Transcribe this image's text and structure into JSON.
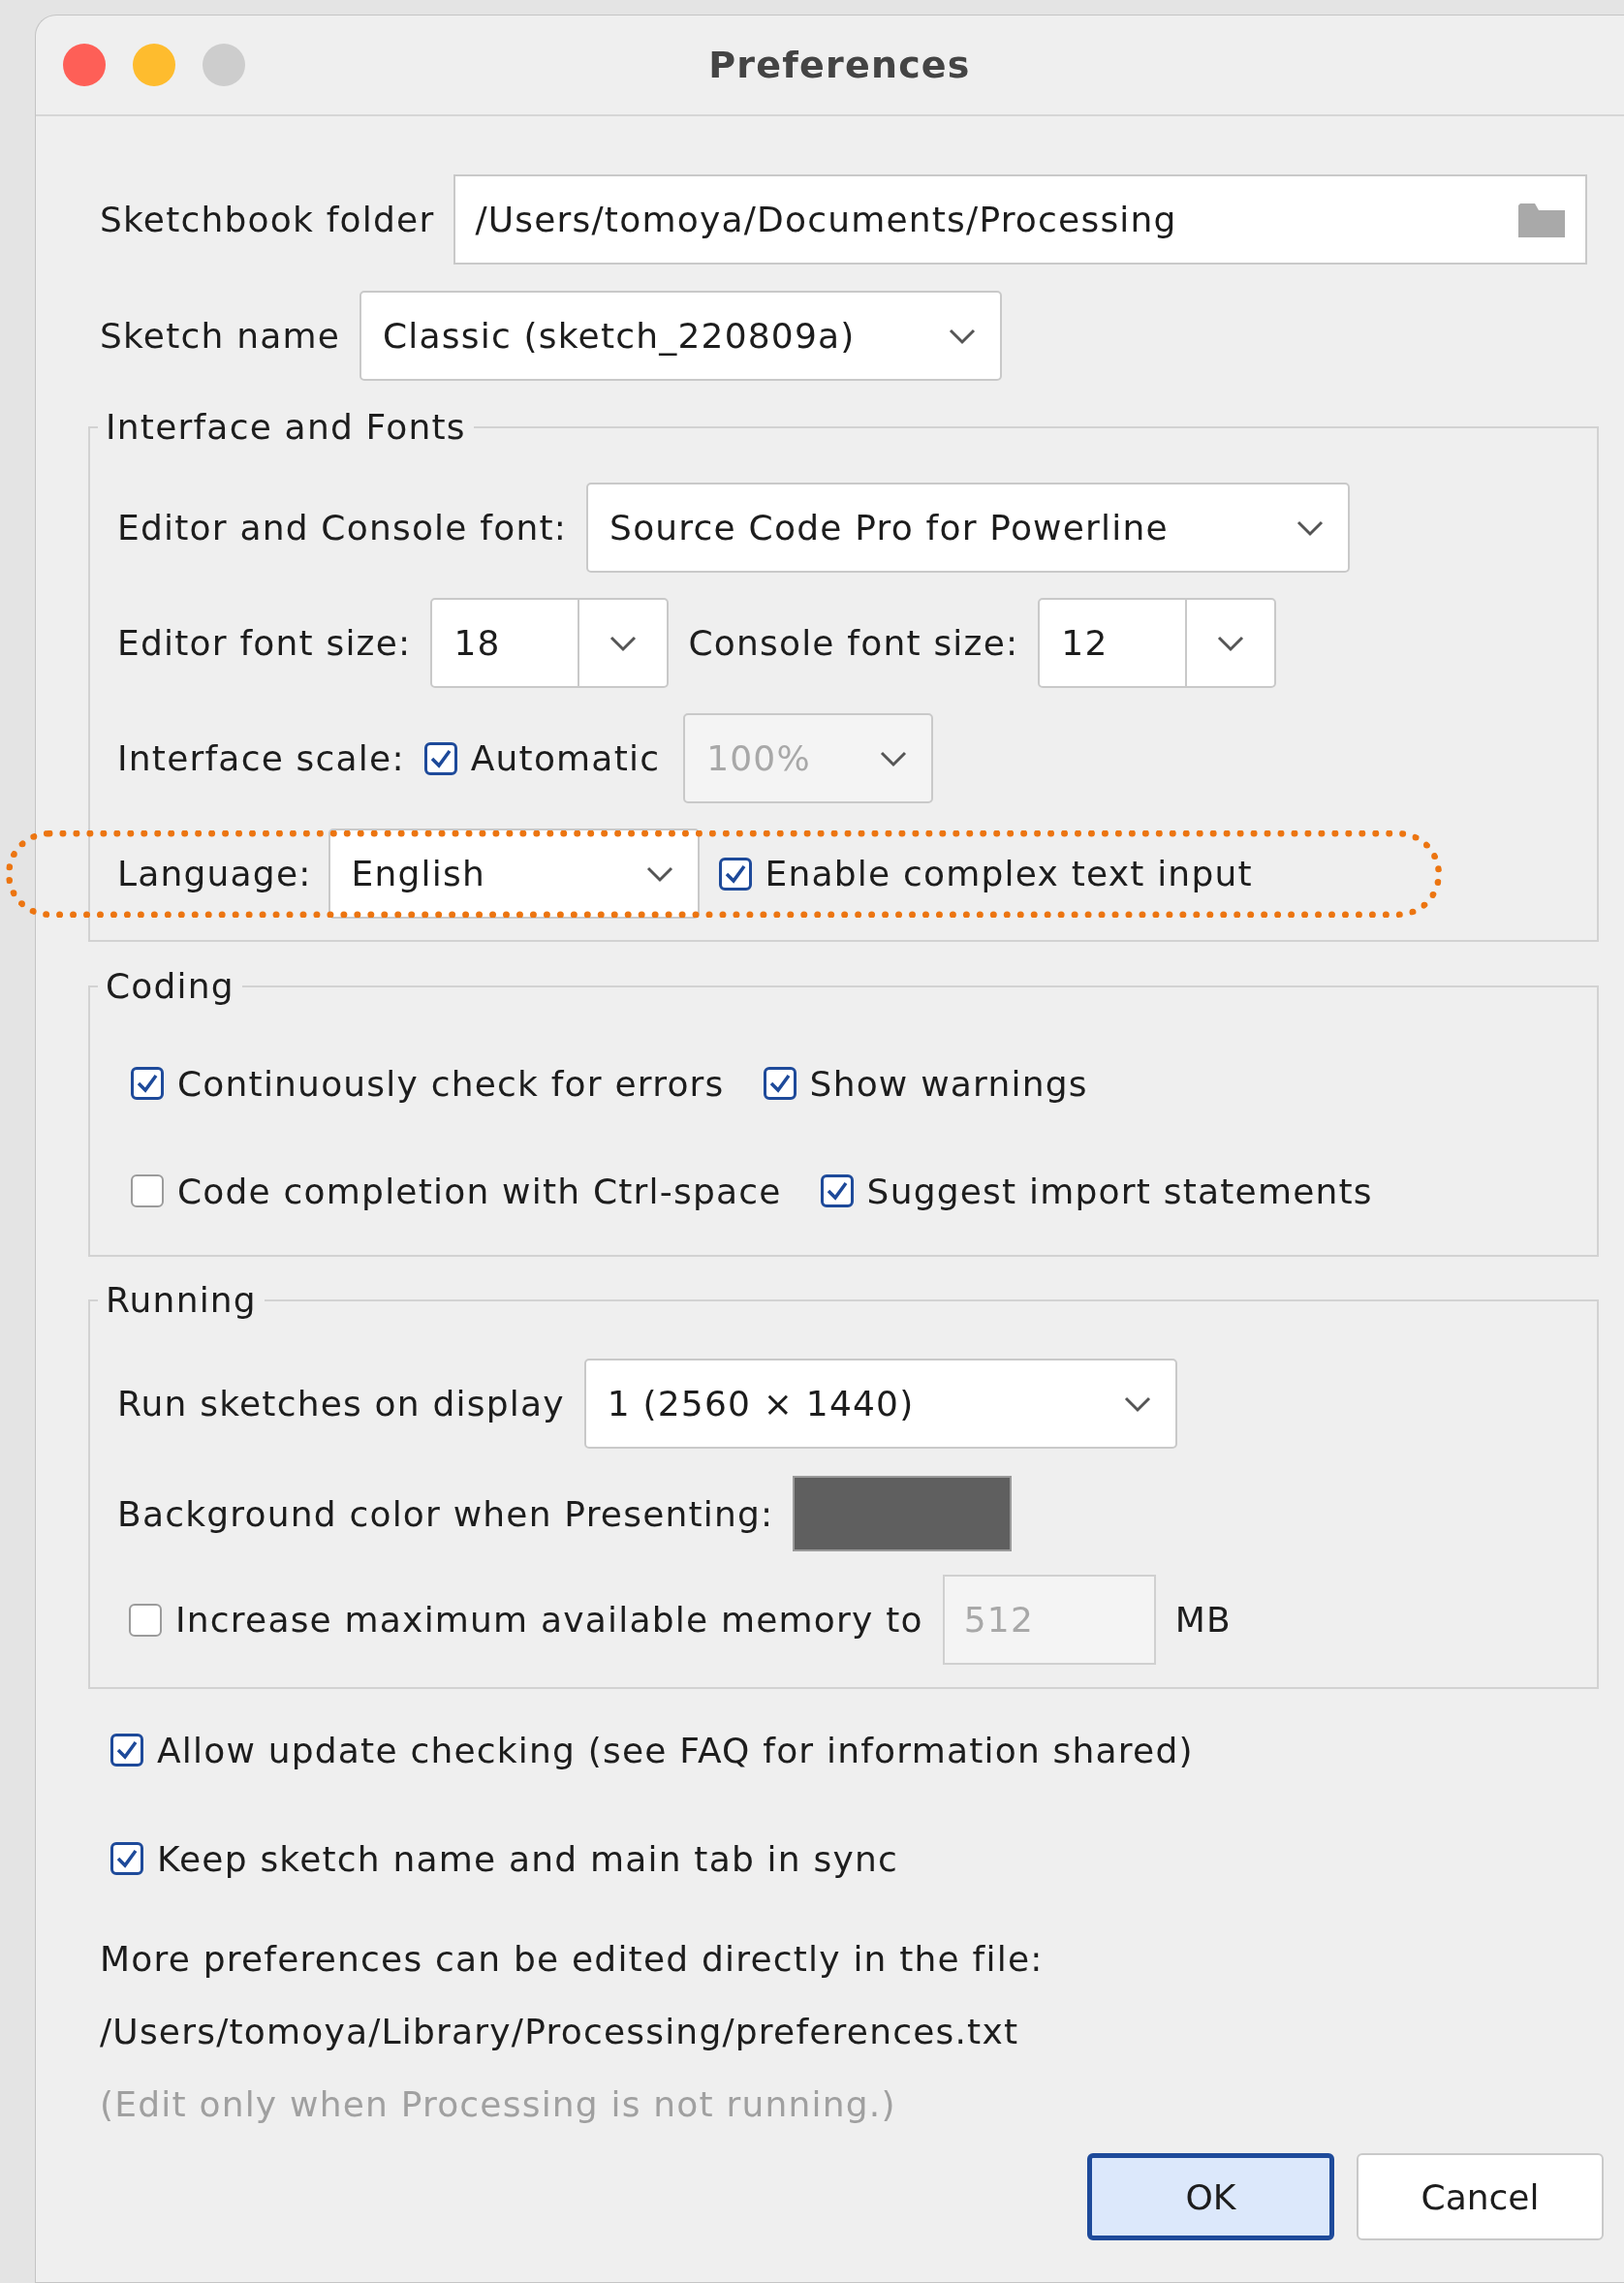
{
  "window": {
    "title": "Preferences",
    "traffic_lights": [
      {
        "color": "#fe5f57"
      },
      {
        "color": "#febc2e"
      },
      {
        "color": "#cdcdcd"
      }
    ]
  },
  "sketchbook_folder": {
    "label": "Sketchbook folder",
    "value": "/Users/tomoya/Documents/Processing"
  },
  "sketch_name": {
    "label": "Sketch name",
    "value": "Classic (sketch_220809a)"
  },
  "interface_and_fonts": {
    "title": "Interface and Fonts",
    "editor_console_font": {
      "label": "Editor and Console font:",
      "value": "Source Code Pro for Powerline"
    },
    "editor_font_size": {
      "label": "Editor font size:",
      "value": "18"
    },
    "console_font_size": {
      "label": "Console font size:",
      "value": "12"
    },
    "interface_scale": {
      "label": "Interface scale:",
      "automatic": {
        "label": "Automatic",
        "checked": true
      },
      "value": "100%",
      "disabled": true
    },
    "language": {
      "label": "Language:",
      "value": "English"
    },
    "complex_text_input": {
      "label": "Enable complex text input",
      "checked": true
    }
  },
  "coding": {
    "title": "Coding",
    "rows": [
      [
        {
          "label": "Continuously check for errors",
          "checked": true
        },
        {
          "label": "Show warnings",
          "checked": true
        }
      ],
      [
        {
          "label": "Code completion with Ctrl-space",
          "checked": false
        },
        {
          "label": "Suggest import statements",
          "checked": true
        }
      ]
    ]
  },
  "running": {
    "title": "Running",
    "display": {
      "label": "Run sketches on display",
      "value": "1 (2560 × 1440)"
    },
    "background": {
      "label": "Background color when Presenting:",
      "color": "#5f5f5f"
    },
    "memory": {
      "label": "Increase maximum available memory to",
      "checked": false,
      "value": "512",
      "unit": "MB"
    }
  },
  "options": [
    {
      "label": "Allow update checking (see FAQ for information shared)",
      "checked": true
    },
    {
      "label": "Keep sketch name and main tab in sync",
      "checked": true
    }
  ],
  "note": {
    "lines": [
      "More preferences can be edited directly in the file:",
      "/Users/tomoya/Library/Processing/preferences.txt"
    ],
    "hint": "(Edit only when Processing is not running.)"
  },
  "buttons": [
    {
      "label": "OK",
      "default": true
    },
    {
      "label": "Cancel",
      "default": false
    }
  ]
}
